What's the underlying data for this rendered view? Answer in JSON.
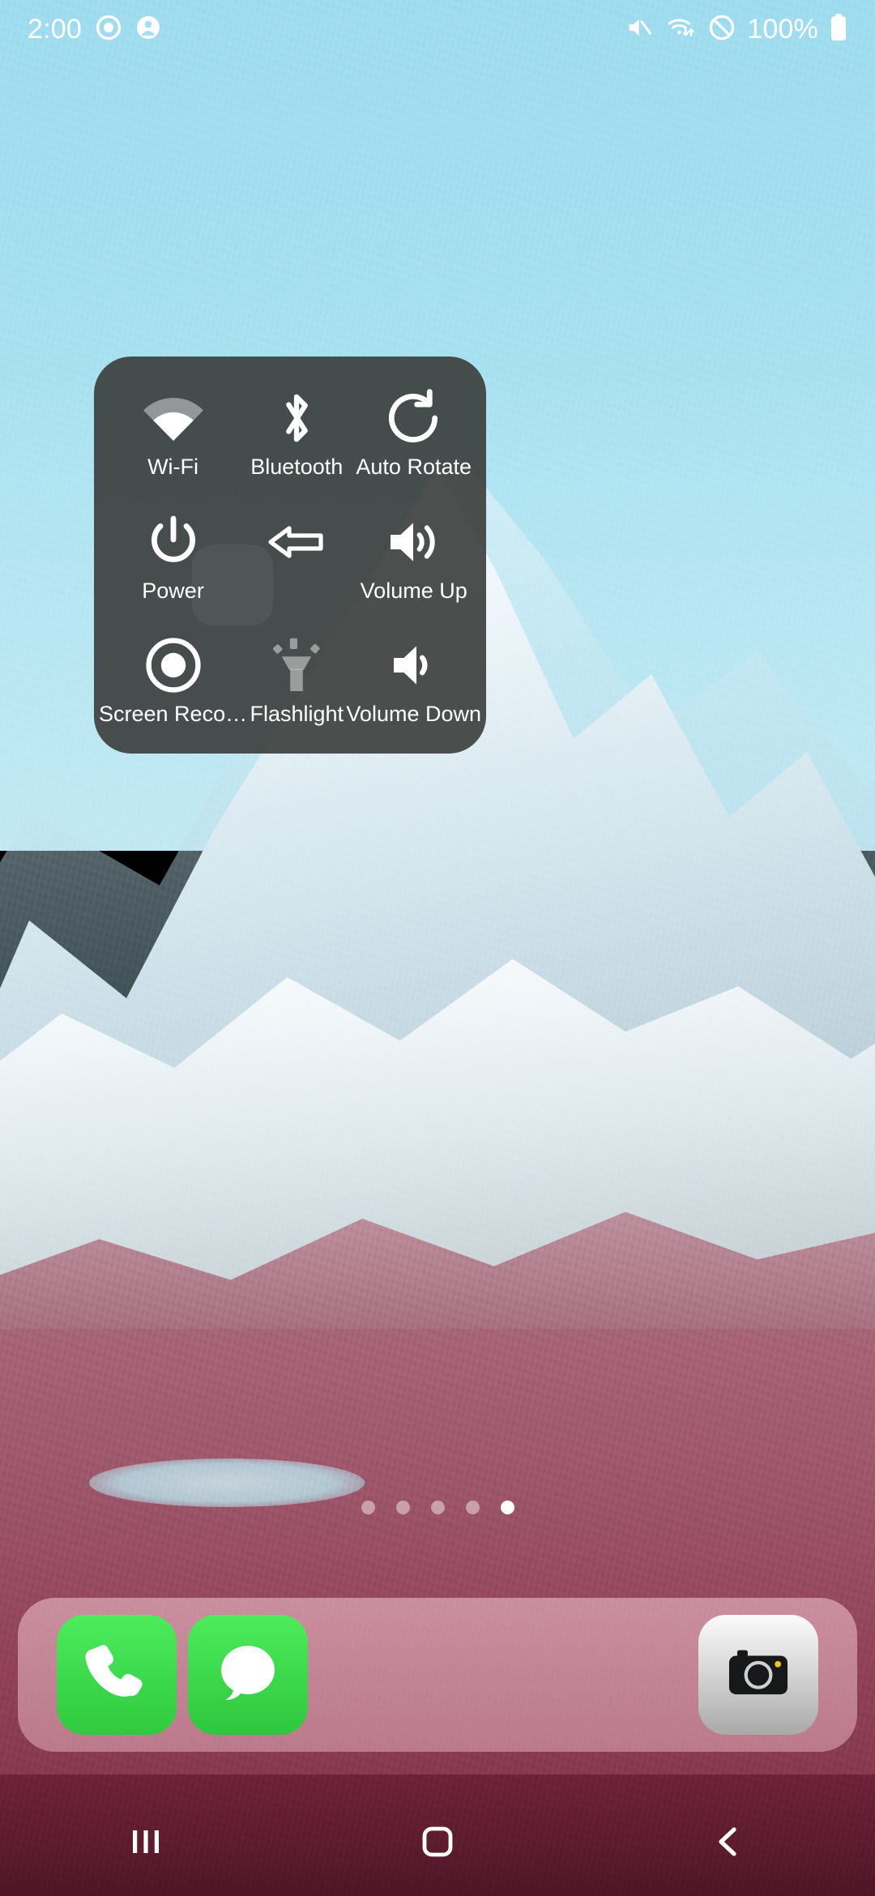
{
  "status_bar": {
    "clock": "2:00",
    "left_icons": [
      {
        "name": "screen-recording-indicator-icon",
        "glyph": "record-circle"
      },
      {
        "name": "account-profile-icon",
        "glyph": "person"
      }
    ],
    "right_icons": [
      {
        "name": "volume-mute-icon",
        "glyph": "speaker-muted"
      },
      {
        "name": "wifi-data-transfer-icon",
        "glyph": "wifi-updown"
      },
      {
        "name": "do-not-disturb-icon",
        "glyph": "circle-slash"
      }
    ],
    "battery_percent": "100%",
    "battery_icon": "battery-full-icon"
  },
  "assistive_menu": {
    "items": [
      {
        "id": "wifi",
        "label": "Wi-Fi",
        "icon": "wifi-icon",
        "state": "on"
      },
      {
        "id": "bluetooth",
        "label": "Bluetooth",
        "icon": "bluetooth-icon",
        "state": "on"
      },
      {
        "id": "auto-rotate",
        "label": "Auto Rotate",
        "icon": "rotate-icon",
        "state": "on"
      },
      {
        "id": "power",
        "label": "Power",
        "icon": "power-icon",
        "state": "on"
      },
      {
        "id": "back",
        "label": "",
        "icon": "back-arrow-icon",
        "state": "on"
      },
      {
        "id": "volume-up",
        "label": "Volume Up",
        "icon": "volume-up-icon",
        "state": "on"
      },
      {
        "id": "screen-record",
        "label": "Screen Reco…",
        "icon": "record-icon",
        "state": "on"
      },
      {
        "id": "flashlight",
        "label": "Flashlight",
        "icon": "flashlight-icon",
        "state": "off"
      },
      {
        "id": "volume-down",
        "label": "Volume Down",
        "icon": "volume-down-icon",
        "state": "on"
      }
    ]
  },
  "home_screen": {
    "page_dots": {
      "count": 5,
      "active_index": 4
    },
    "dock": [
      {
        "id": "phone",
        "icon": "phone-icon"
      },
      {
        "id": "messages",
        "icon": "message-bubble-icon"
      },
      {
        "id": "camera",
        "icon": "camera-icon"
      }
    ]
  },
  "nav_bar": [
    {
      "id": "recents",
      "icon": "recents-icon"
    },
    {
      "id": "home",
      "icon": "home-icon"
    },
    {
      "id": "back",
      "icon": "back-chevron-icon"
    }
  ],
  "colors": {
    "panel_bg": "#3a3c3a",
    "accent_green": "#30c93f",
    "dock_bg": "#e0a7b7",
    "sky": "#a6e0f0"
  }
}
